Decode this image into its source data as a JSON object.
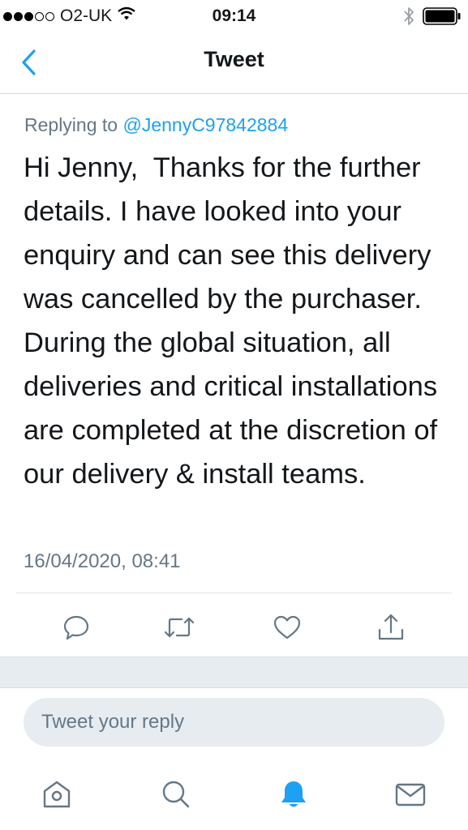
{
  "status_bar": {
    "carrier": "O2-UK",
    "time": "09:14",
    "signal_bars_filled": 3,
    "signal_bars_total": 5,
    "icons": [
      "wifi-icon",
      "bluetooth-icon",
      "battery-icon"
    ]
  },
  "nav": {
    "title": "Tweet",
    "back_icon": "chevron-left-icon"
  },
  "tweet": {
    "replying_to_label": "Replying to",
    "replying_to_handle": "@JennyC97842884",
    "text": "Hi Jenny,  Thanks for the further details. I have looked into your enquiry and can see this delivery was cancelled by the purchaser. During the global situation, all deliveries and critical installations are completed at the discretion of our delivery & install teams.",
    "timestamp": "16/04/2020, 08:41"
  },
  "actions": [
    "reply-icon",
    "retweet-icon",
    "like-icon",
    "share-icon"
  ],
  "reply_box": {
    "placeholder": "Tweet your reply"
  },
  "tab_bar": {
    "tabs": [
      "home-icon",
      "search-icon",
      "notifications-icon",
      "messages-icon"
    ],
    "active": "notifications-icon"
  },
  "colors": {
    "accent": "#1da1f2",
    "secondary_text": "#657786",
    "primary_text": "#14171a",
    "divider": "#e1e8ed",
    "band": "#e6ecf0"
  }
}
